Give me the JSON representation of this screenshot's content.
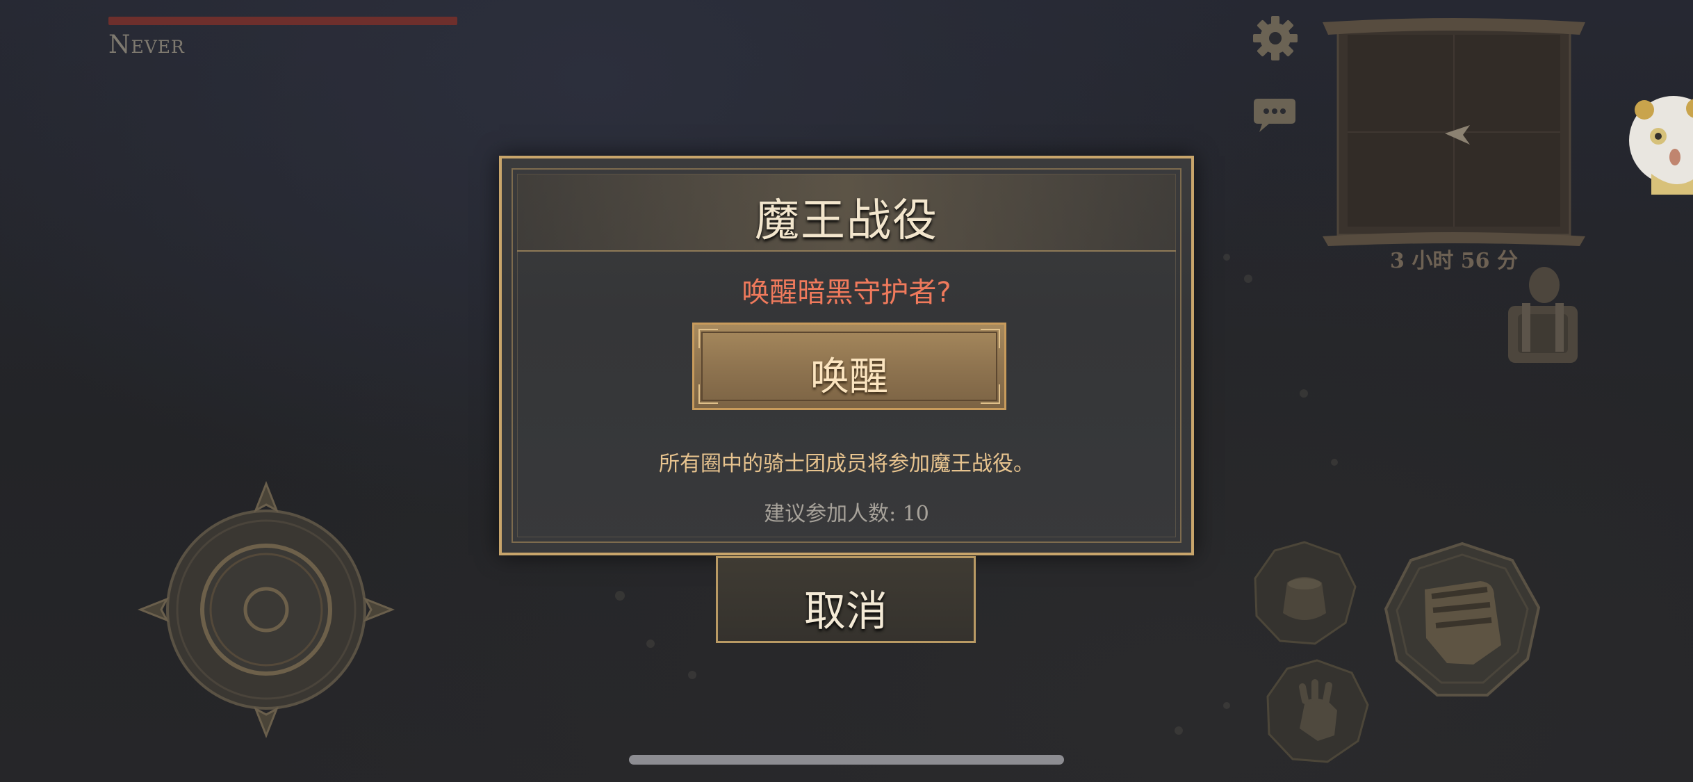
{
  "hud": {
    "player_name": "Never",
    "hp_fraction": 1.0,
    "map_timer": "3 小时 56 分"
  },
  "dialog": {
    "title": "魔王战役",
    "question": "唤醒暗黑守护者?",
    "awaken_label": "唤醒",
    "description": "所有圈中的骑士团成员将参加魔王战役。",
    "recommend": "建议参加人数: 10"
  },
  "cancel_label": "取消",
  "icons": {
    "settings": "gear-icon",
    "chat": "chat-bubble-icon",
    "map": "scroll-map-icon",
    "companion": "panda-avatar-icon",
    "backpack": "backpack-icon",
    "joystick": "joystick-icon",
    "item": "item-pouch-icon",
    "attack": "fist-icon",
    "grab": "hand-icon"
  },
  "colors": {
    "gold_border": "#c8a56b",
    "question_red": "#f07a5c",
    "hp_red": "#6e2f2c"
  }
}
